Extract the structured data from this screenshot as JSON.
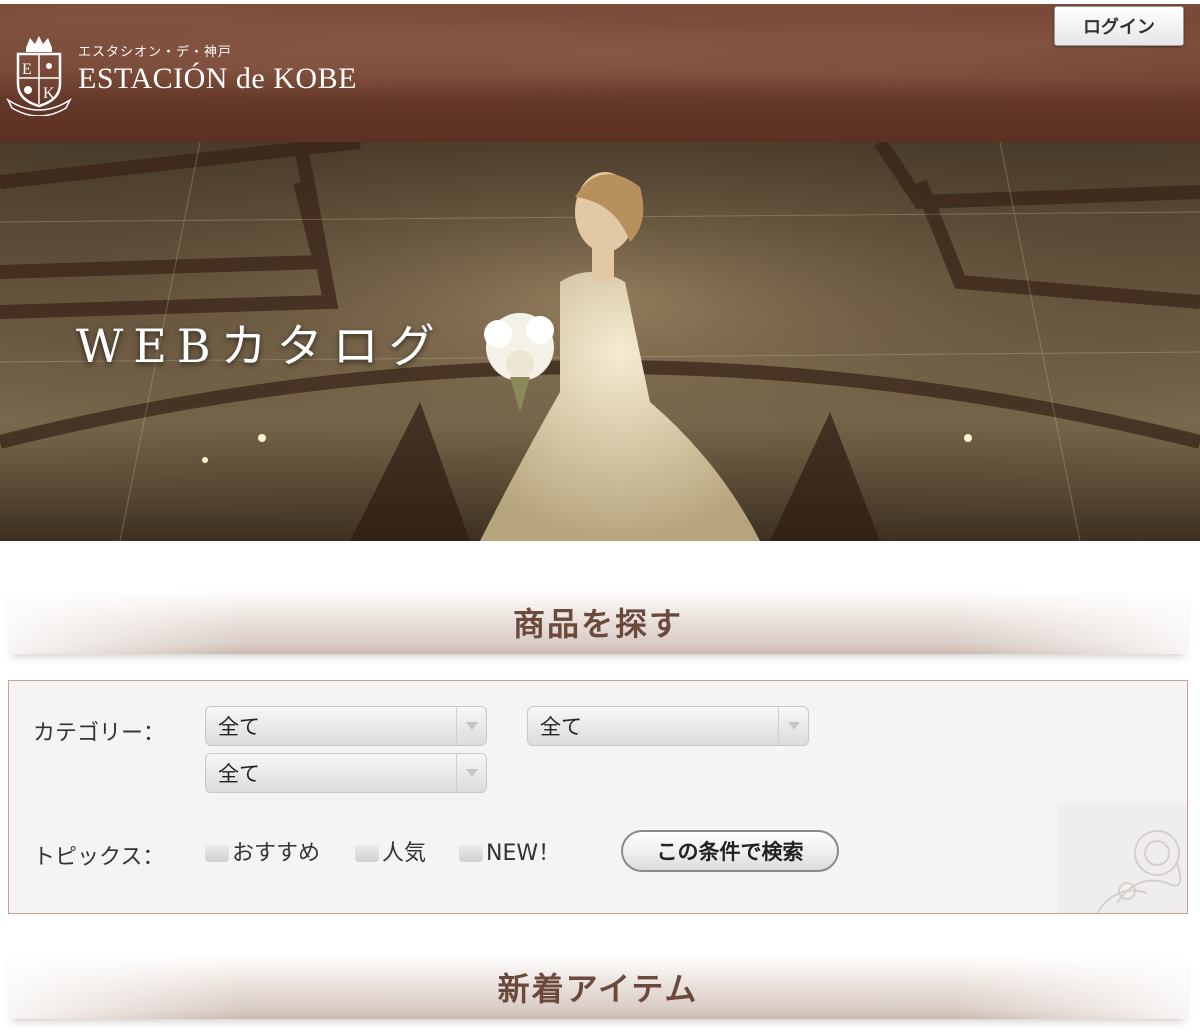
{
  "header": {
    "logo_sub": "エスタシオン・デ・神戸",
    "logo_main": "ESTACIÓN de KOBE",
    "login_label": "ログイン"
  },
  "hero": {
    "title": "WEBカタログ"
  },
  "search_section": {
    "title": "商品を探す",
    "category_label": "カテゴリー：",
    "category_selects": [
      "全て",
      "全て",
      "全て"
    ],
    "topics_label": "トピックス：",
    "topics": [
      "おすすめ",
      "人気",
      "NEW！"
    ],
    "search_button": "この条件で検索"
  },
  "new_items_section": {
    "title": "新着アイテム"
  },
  "colors": {
    "header_brown": "#6a3c2c",
    "section_title": "#6b4a3c",
    "panel_border": "#c4a595"
  }
}
